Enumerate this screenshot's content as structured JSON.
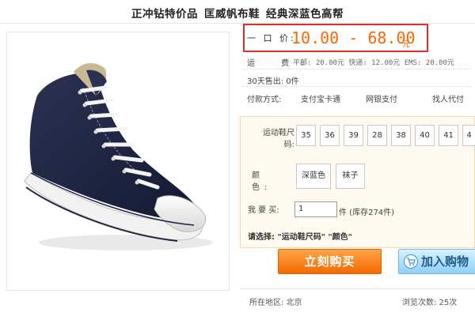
{
  "title": {
    "part1": "正冲钻特价品",
    "part2": "匡威帆布鞋",
    "part3": "经典深蓝色高帮"
  },
  "price": {
    "label": "一 口 价:",
    "value": "10.00 - 68.00",
    "unit": "元"
  },
  "shipping": {
    "label": "运 费:",
    "text": "平邮: 20.00元 快递: 12.00元 EMS: 20.00元"
  },
  "sold": {
    "text": "30天售出: 0件"
  },
  "payment": {
    "label": "付款方式:",
    "options": [
      "支付宝卡通",
      "网银支付",
      "找人代付"
    ]
  },
  "size": {
    "label_line1": "运动鞋尺",
    "label_line2": "码:",
    "options": [
      "35",
      "36",
      "39",
      "28",
      "38",
      "40",
      "41",
      "4"
    ]
  },
  "color": {
    "label": "颜 色:",
    "options": [
      "深蓝色",
      "袜子"
    ]
  },
  "quantity": {
    "label": "我 要 买:",
    "value": "1",
    "stock": "件 (库存274件)"
  },
  "choose": {
    "prefix": "请选择:",
    "selection": "\"运动鞋尺码\" \"颜色\""
  },
  "buttons": {
    "buy": "立刻购买",
    "cart": "加入购物"
  },
  "location": {
    "text": "所在地区: 北京"
  },
  "views": {
    "text": "浏览次数: 25次"
  },
  "colors": {
    "accent": "#ff6600",
    "highlight_border": "#e22b2b",
    "buy_button": "#f36a00",
    "cart_button": "#8fd0f7",
    "spec_bg": "#fffaf0"
  }
}
